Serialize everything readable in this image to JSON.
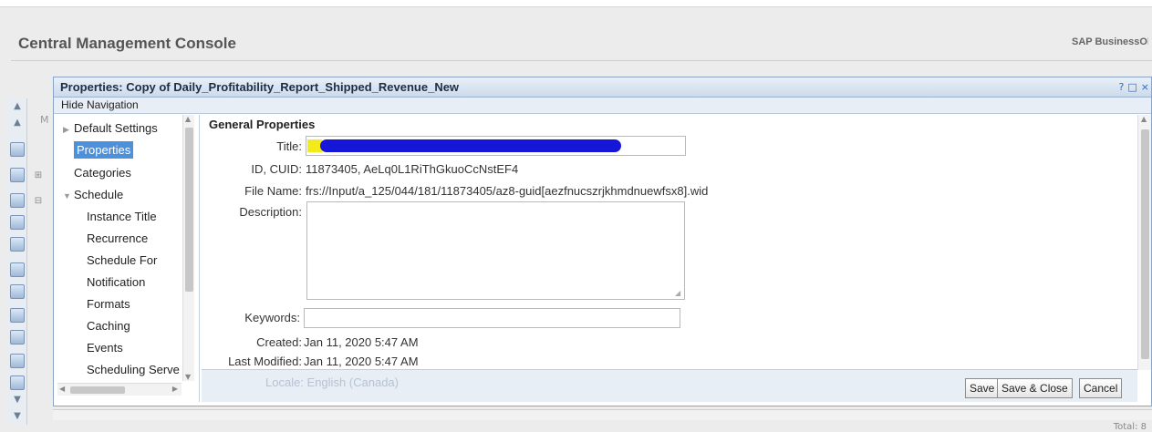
{
  "console": {
    "title": "Central Management Console",
    "brand": "SAP BusinessObjects",
    "total": "Total: 8"
  },
  "dialog": {
    "title": "Properties: Copy of Daily_Profitability_Report_Shipped_Revenue_New",
    "controls": {
      "help": "?",
      "maximize": "□",
      "close": "×"
    },
    "hide_navigation": "Hide Navigation"
  },
  "nav": {
    "items": [
      {
        "label": "Default Settings",
        "arrow": "▶"
      },
      {
        "label": "Properties"
      },
      {
        "label": "Categories"
      },
      {
        "label": "Schedule",
        "arrow": "▼"
      },
      {
        "label": "Instance Title"
      },
      {
        "label": "Recurrence"
      },
      {
        "label": "Schedule For"
      },
      {
        "label": "Notification"
      },
      {
        "label": "Formats"
      },
      {
        "label": "Caching"
      },
      {
        "label": "Events"
      },
      {
        "label": "Scheduling Serve"
      }
    ],
    "truncated_label": "M"
  },
  "general": {
    "heading": "General Properties",
    "title_label": "Title:",
    "title_value": "",
    "id_label": "ID, CUID:",
    "id_value": "11873405, AeLq0L1RiThGkuoCcNstEF4",
    "file_label": "File Name:",
    "file_value": "frs://Input/a_125/044/181/11873405/az8-guid[aezfnucszrjkhmdnuewfsx8].wid",
    "description_label": "Description:",
    "description_value": "",
    "keywords_label": "Keywords:",
    "keywords_value": "",
    "created_label": "Created:",
    "created_value": "Jan 11, 2020 5:47 AM",
    "modified_label": "Last Modified:",
    "modified_value": "Jan 11, 2020 5:47 AM",
    "locale_text": "Locale: English (Canada)"
  },
  "buttons": {
    "save": "Save",
    "save_close": "Save & Close",
    "cancel": "Cancel"
  },
  "colors": {
    "selection": "#4d90dc",
    "redaction": "#1616d8",
    "dialog_border": "#8ba4c6"
  }
}
